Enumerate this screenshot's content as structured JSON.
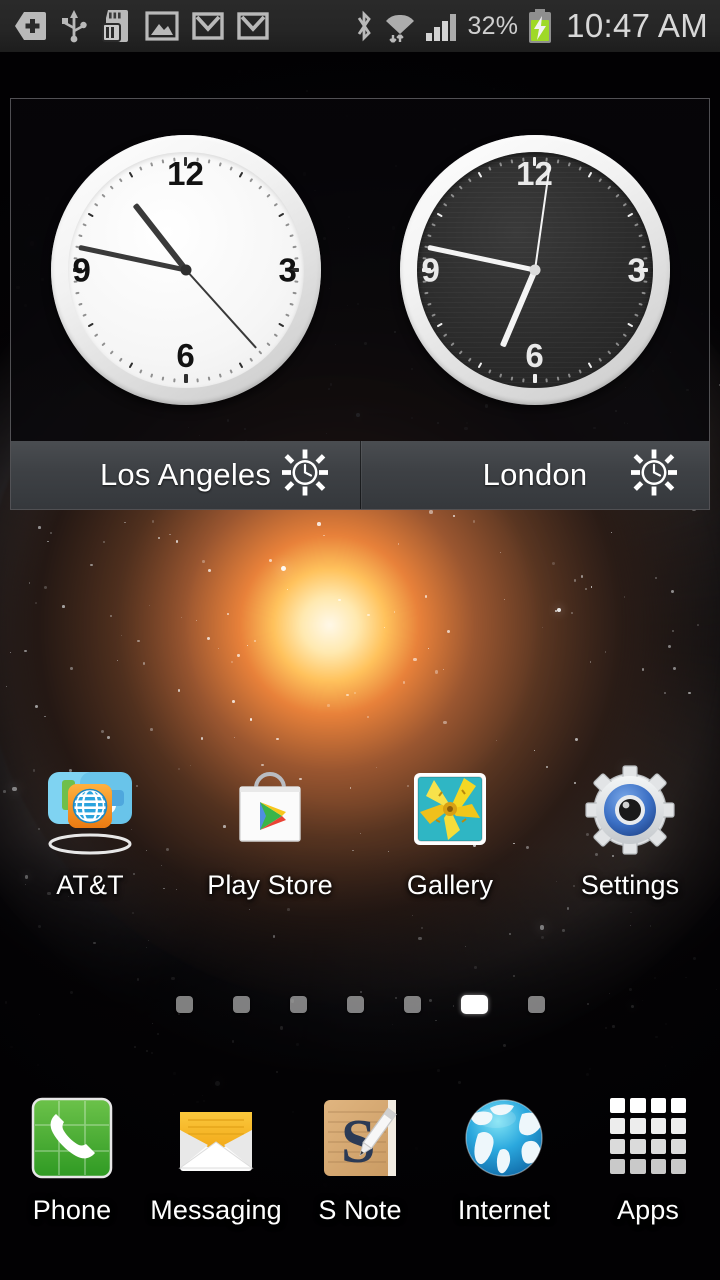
{
  "statusbar": {
    "time": "10:47 AM",
    "battery_percent": "32%",
    "icons": [
      {
        "name": "medical-plus-tag-icon",
        "glyph": "plus-tag"
      },
      {
        "name": "usb-icon",
        "glyph": "usb"
      },
      {
        "name": "sd-card-alert-icon",
        "glyph": "sdcard"
      },
      {
        "name": "image-saved-icon",
        "glyph": "picture"
      },
      {
        "name": "gmail-icon",
        "glyph": "gmail"
      },
      {
        "name": "gmail-icon-2",
        "glyph": "gmail"
      }
    ],
    "right_icons": [
      {
        "name": "bluetooth-icon",
        "glyph": "bluetooth"
      },
      {
        "name": "wifi-transfer-icon",
        "glyph": "wifi"
      },
      {
        "name": "cellular-signal-icon",
        "glyph": "signal",
        "bars_filled": 4,
        "bars_total": 5
      },
      {
        "name": "battery-charging-icon",
        "glyph": "battery-charging",
        "color": "#9fd927"
      }
    ]
  },
  "widget": {
    "name": "dual-clock-widget",
    "clocks": [
      {
        "city": "Los Angeles",
        "theme": "light",
        "time": "10:47",
        "hour_deg": 322,
        "minute_deg": 282,
        "second_deg": 138,
        "daynight": "day",
        "numerals": [
          "12",
          "3",
          "6",
          "9"
        ]
      },
      {
        "city": "London",
        "theme": "dark",
        "time": "18:47",
        "hour_deg": 203,
        "minute_deg": 282,
        "second_deg": 8,
        "daynight": "day",
        "numerals": [
          "12",
          "3",
          "6",
          "9"
        ]
      }
    ]
  },
  "apps": [
    {
      "label": "AT&T",
      "icon": "att-folder-icon"
    },
    {
      "label": "Play Store",
      "icon": "play-store-icon"
    },
    {
      "label": "Gallery",
      "icon": "gallery-icon"
    },
    {
      "label": "Settings",
      "icon": "settings-gear-icon"
    }
  ],
  "pages": {
    "count": 7,
    "active_index": 5
  },
  "dock": [
    {
      "label": "Phone",
      "icon": "phone-icon"
    },
    {
      "label": "Messaging",
      "icon": "messaging-envelope-icon"
    },
    {
      "label": "S Note",
      "icon": "s-note-icon"
    },
    {
      "label": "Internet",
      "icon": "internet-globe-icon"
    },
    {
      "label": "Apps",
      "icon": "apps-drawer-icon"
    }
  ],
  "colors": {
    "status_bg": "#262626",
    "widget_bar": "#3e4145",
    "battery_green": "#9fd927",
    "label_text": "#ffffff"
  }
}
